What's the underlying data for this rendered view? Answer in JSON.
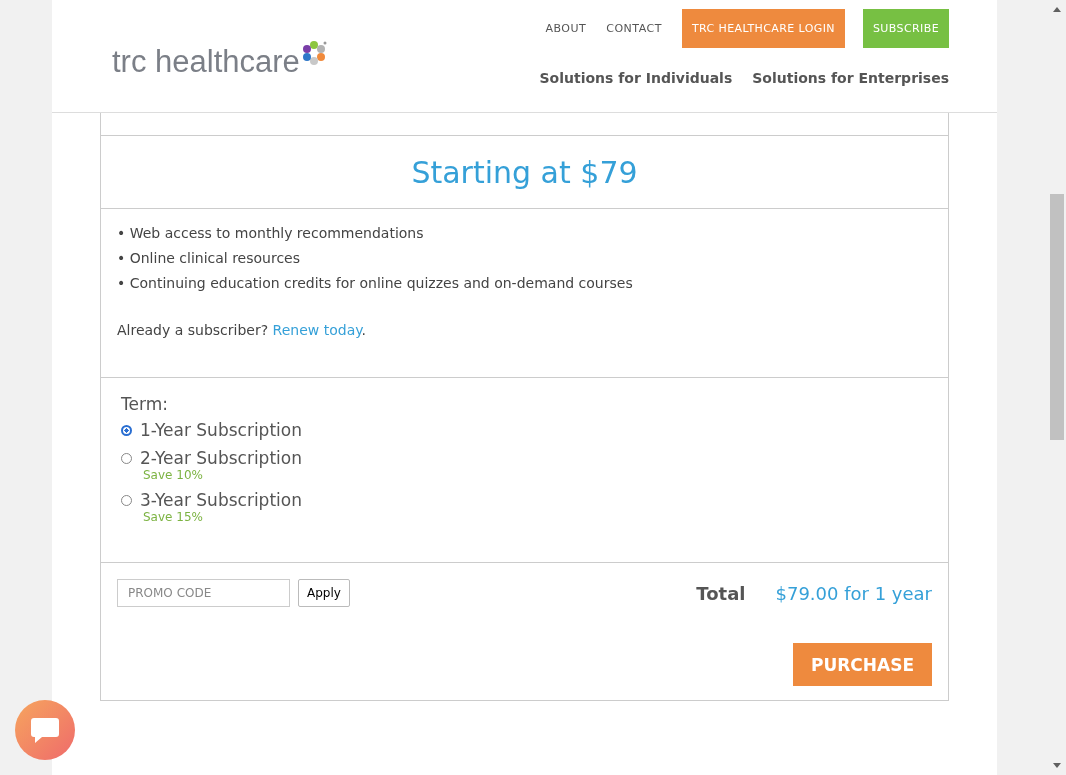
{
  "header": {
    "logo": "trc healthcare",
    "top_links": [
      "ABOUT",
      "CONTACT"
    ],
    "buttons": [
      {
        "label": "TRC HEALTHCARE LOGIN",
        "kind": "login"
      },
      {
        "label": "SUBSCRIBE",
        "kind": "subscribe"
      }
    ],
    "nav": [
      "Solutions for Individuals",
      "Solutions for Enterprises"
    ]
  },
  "price": "Starting at $79",
  "features": [
    "• Web access to monthly recommendations",
    "• Online clinical resources",
    "• Continuing education credits for online quizzes and on-demand courses"
  ],
  "renew": {
    "text": "Already a subscriber?",
    "link": "Renew today",
    "after": "."
  },
  "term": {
    "label": "Term:",
    "options": [
      {
        "label": "1-Year Subscription",
        "selected": true
      },
      {
        "label": "2-Year Subscription",
        "note": "Save 10%",
        "selected": false
      },
      {
        "label": "3-Year Subscription",
        "note": "Save 15%",
        "selected": false
      }
    ]
  },
  "promo": {
    "placeholder": "PROMO CODE",
    "button": "Apply"
  },
  "total": {
    "label": "Total",
    "value": "$79.00 for 1 year"
  },
  "purchase": "PURCHASE"
}
